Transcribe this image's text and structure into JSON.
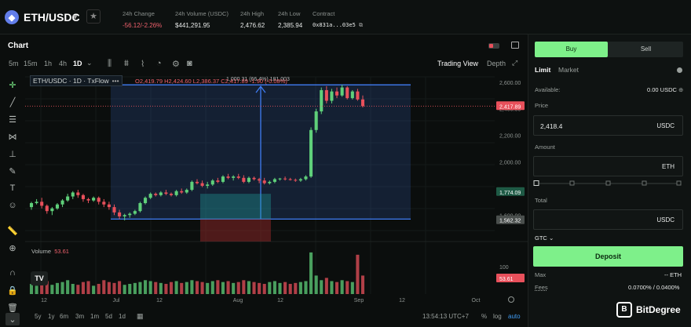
{
  "header": {
    "coin_symbol": "◆",
    "pair": "ETH/USDC",
    "stats": [
      {
        "label": "24h Change",
        "value": "-56.12/-2.26%",
        "negative": true
      },
      {
        "label": "24h Volume (USDC)",
        "value": "$441,291.95",
        "negative": false
      },
      {
        "label": "24h High",
        "value": "2,476.62",
        "negative": false
      },
      {
        "label": "24h Low",
        "value": "2,385.94",
        "negative": false
      },
      {
        "label": "Contract",
        "value": "0x831a...03e5",
        "negative": false
      }
    ]
  },
  "chart_panel": {
    "title": "Chart",
    "timeframes": [
      "5m",
      "15m",
      "1h",
      "4h",
      "1D"
    ],
    "active_timeframe": "1D",
    "views": {
      "trading_view": "Trading View",
      "depth": "Depth"
    },
    "legend": "ETH/USDC · 1D · TxFlow",
    "ohlc": "O2,419.79  H2,424.60  L2,386.37  C2,417.89  -1.90 (-0.08%)",
    "measure_label": "1,000.31 (66.4%) 181,003",
    "volume_label": "Volume",
    "volume_value": "53.61",
    "volume_axis": "100",
    "price_ticks": [
      "2,600.00",
      "2,400.00",
      "2,200.00",
      "2,000.00",
      "1,800.00",
      "1,600.00"
    ],
    "price_tags": {
      "current": "2,417.89",
      "measure_top": "1,774.09",
      "measure_bottom": "1,562.32",
      "volume": "53.61"
    },
    "date_ticks": [
      "12",
      "Jul",
      "12",
      "Aug",
      "12",
      "Sep",
      "12",
      "Oct"
    ],
    "ranges": [
      "5y",
      "1y",
      "6m",
      "3m",
      "1m",
      "5d",
      "1d"
    ],
    "clock": "13:54:13 UTC+7",
    "pct": "%",
    "log": "log",
    "auto": "auto"
  },
  "chart_data": {
    "type": "candlestick",
    "ylim": [
      1460,
      2640
    ],
    "candles": [
      [
        1660,
        1700,
        1640,
        1690
      ],
      [
        1690,
        1720,
        1680,
        1700
      ],
      [
        1700,
        1730,
        1650,
        1670
      ],
      [
        1670,
        1680,
        1610,
        1630
      ],
      [
        1630,
        1660,
        1600,
        1650
      ],
      [
        1650,
        1690,
        1640,
        1680
      ],
      [
        1680,
        1720,
        1660,
        1710
      ],
      [
        1710,
        1760,
        1700,
        1740
      ],
      [
        1740,
        1780,
        1720,
        1770
      ],
      [
        1770,
        1790,
        1730,
        1750
      ],
      [
        1750,
        1760,
        1700,
        1720
      ],
      [
        1720,
        1730,
        1690,
        1710
      ],
      [
        1710,
        1740,
        1700,
        1730
      ],
      [
        1730,
        1740,
        1680,
        1700
      ],
      [
        1700,
        1720,
        1660,
        1680
      ],
      [
        1680,
        1700,
        1640,
        1660
      ],
      [
        1660,
        1680,
        1600,
        1620
      ],
      [
        1620,
        1640,
        1570,
        1590
      ],
      [
        1590,
        1610,
        1560,
        1600
      ],
      [
        1600,
        1620,
        1580,
        1610
      ],
      [
        1610,
        1640,
        1600,
        1630
      ],
      [
        1630,
        1700,
        1620,
        1690
      ],
      [
        1690,
        1740,
        1680,
        1730
      ],
      [
        1730,
        1770,
        1720,
        1760
      ],
      [
        1760,
        1770,
        1740,
        1750
      ],
      [
        1750,
        1780,
        1740,
        1770
      ],
      [
        1770,
        1790,
        1750,
        1760
      ],
      [
        1760,
        1770,
        1740,
        1750
      ],
      [
        1750,
        1790,
        1740,
        1780
      ],
      [
        1780,
        1800,
        1760,
        1770
      ],
      [
        1770,
        1800,
        1760,
        1790
      ],
      [
        1790,
        1860,
        1780,
        1850
      ],
      [
        1850,
        1870,
        1830,
        1840
      ],
      [
        1840,
        1860,
        1810,
        1820
      ],
      [
        1820,
        1850,
        1800,
        1830
      ],
      [
        1830,
        1870,
        1820,
        1860
      ],
      [
        1860,
        1880,
        1840,
        1850
      ],
      [
        1850,
        1900,
        1840,
        1890
      ],
      [
        1890,
        1910,
        1870,
        1880
      ],
      [
        1880,
        1900,
        1860,
        1890
      ],
      [
        1890,
        1910,
        1870,
        1880
      ],
      [
        1880,
        1900,
        1840,
        1850
      ],
      [
        1850,
        1890,
        1840,
        1880
      ],
      [
        1880,
        1890,
        1860,
        1870
      ],
      [
        1870,
        1880,
        1840,
        1860
      ],
      [
        1860,
        1880,
        1830,
        1840
      ],
      [
        1840,
        1860,
        1830,
        1850
      ],
      [
        1850,
        1880,
        1840,
        1870
      ],
      [
        1870,
        1880,
        1860,
        1875
      ],
      [
        1875,
        1890,
        1860,
        1870
      ],
      [
        1870,
        1880,
        1860,
        1865
      ],
      [
        1865,
        1875,
        1850,
        1860
      ],
      [
        1860,
        1880,
        1850,
        1870
      ],
      [
        1870,
        1900,
        1860,
        1890
      ],
      [
        1890,
        2260,
        1880,
        2240
      ],
      [
        2240,
        2400,
        2220,
        2380
      ],
      [
        2380,
        2560,
        2360,
        2540
      ],
      [
        2540,
        2570,
        2440,
        2460
      ],
      [
        2460,
        2550,
        2440,
        2530
      ],
      [
        2530,
        2560,
        2480,
        2500
      ],
      [
        2500,
        2580,
        2490,
        2560
      ],
      [
        2560,
        2570,
        2470,
        2480
      ],
      [
        2480,
        2540,
        2470,
        2530
      ],
      [
        2530,
        2550,
        2460,
        2470
      ],
      [
        2470,
        2500,
        2410,
        2420
      ]
    ],
    "volume": [
      22,
      18,
      35,
      28,
      20,
      24,
      26,
      30,
      22,
      20,
      26,
      28,
      18,
      22,
      30,
      26,
      24,
      28,
      20,
      22,
      24,
      26,
      30,
      28,
      26,
      24,
      22,
      26,
      28,
      24,
      26,
      30,
      28,
      26,
      24,
      28,
      30,
      26,
      28,
      24,
      26,
      30,
      28,
      26,
      24,
      22,
      26,
      28,
      24,
      26,
      22,
      24,
      26,
      28,
      90,
      40,
      30,
      35,
      28,
      26,
      30,
      28,
      26,
      85,
      40
    ]
  },
  "order_panel": {
    "tabs": {
      "buy": "Buy",
      "sell": "Sell"
    },
    "order_types": {
      "limit": "Limit",
      "market": "Market"
    },
    "available_label": "Available:",
    "available_value": "0.00 USDC",
    "price_label": "Price",
    "price_value": "2,418.4",
    "price_unit": "USDC",
    "amount_label": "Amount",
    "amount_unit": "ETH",
    "total_label": "Total",
    "total_unit": "USDC",
    "tif": "GTC",
    "deposit": "Deposit",
    "max_label": "Max",
    "max_value": "-- ETH",
    "fees_label": "Fees",
    "fees_value": "0.0700% / 0.0400%",
    "brand": "BitDegree"
  },
  "colors": {
    "up": "#5fd07a",
    "down": "#e8505b",
    "accent": "#7ef08a",
    "measure": "#3f7cf4"
  }
}
